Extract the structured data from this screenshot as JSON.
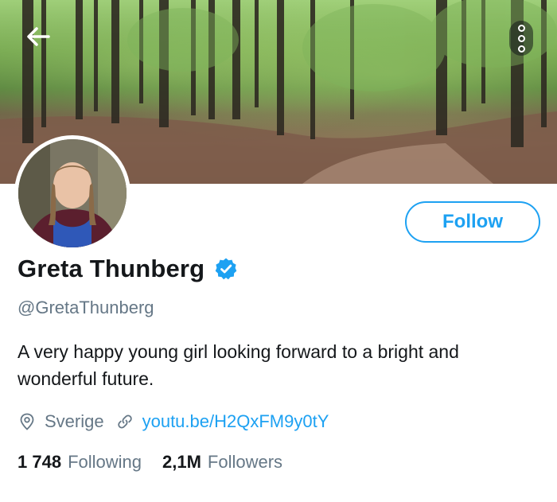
{
  "profile": {
    "name": "Greta Thunberg",
    "handle": "@GretaThunberg",
    "bio": "A very happy young girl looking forward to a bright and wonderful future.",
    "location": "Sverige",
    "link": "youtu.be/H2QxFM9y0tY",
    "verified": true
  },
  "actions": {
    "follow_label": "Follow"
  },
  "stats": {
    "following_count": "1 748",
    "following_label": "Following",
    "followers_count": "2,1M",
    "followers_label": "Followers"
  },
  "icons": {
    "back": "back-arrow-icon",
    "more": "more-options-icon",
    "verified": "verified-badge-icon",
    "location": "location-pin-icon",
    "link": "link-icon"
  },
  "colors": {
    "accent": "#1da1f2",
    "secondary_text": "#657786",
    "primary_text": "#14171a"
  }
}
